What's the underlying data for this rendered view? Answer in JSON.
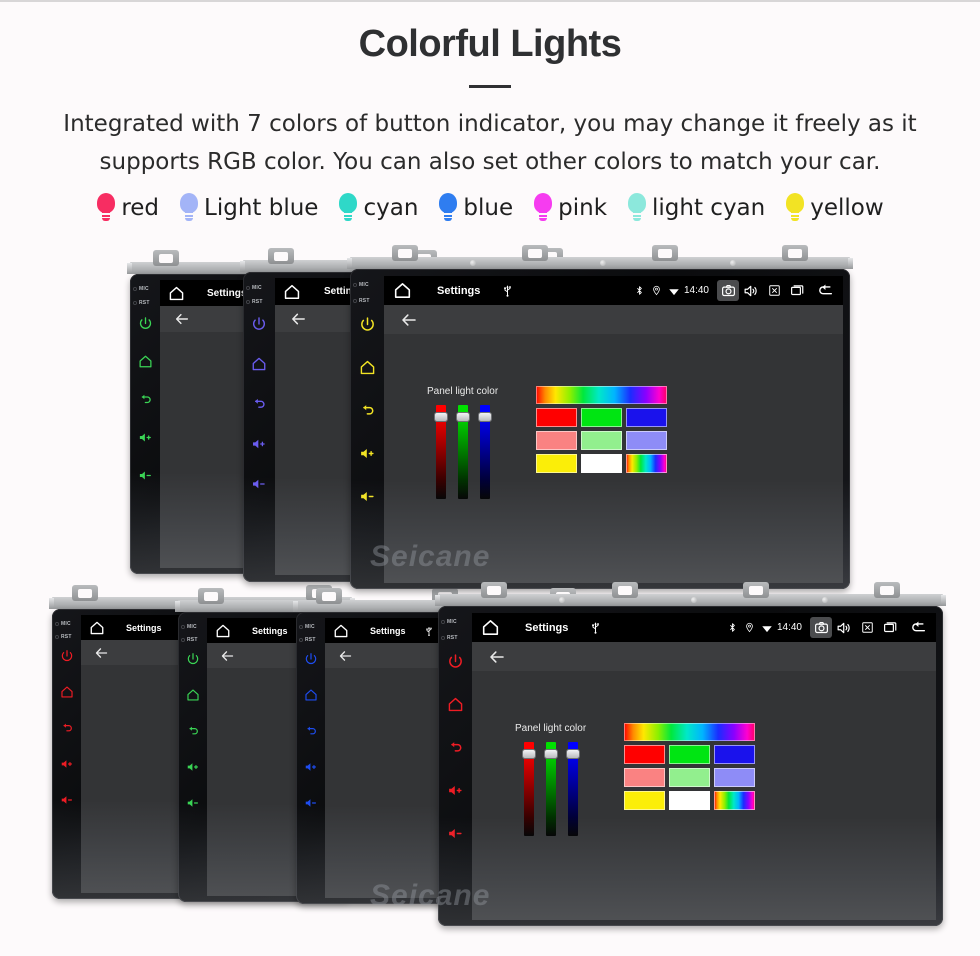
{
  "header": {
    "title": "Colorful Lights",
    "subtitle": "Integrated with 7 colors of button indicator, you may change it freely as it supports RGB color. You can also set other colors to match your car."
  },
  "legend": {
    "items": [
      {
        "label": "red",
        "color": "#f72d62",
        "icon": "bulb-icon"
      },
      {
        "label": "Light blue",
        "color": "#a3b4f7",
        "icon": "bulb-icon"
      },
      {
        "label": "cyan",
        "color": "#2fd8c8",
        "icon": "bulb-icon"
      },
      {
        "label": "blue",
        "color": "#2f7df0",
        "icon": "bulb-icon"
      },
      {
        "label": "pink",
        "color": "#f63cf0",
        "icon": "bulb-icon"
      },
      {
        "label": "light cyan",
        "color": "#8ce8dc",
        "icon": "bulb-icon"
      },
      {
        "label": "yellow",
        "color": "#f2e324",
        "icon": "bulb-icon"
      }
    ]
  },
  "device": {
    "bezel_labels": {
      "mic": "MIC",
      "rst": "RST"
    },
    "hardware_buttons": [
      {
        "name": "power-button",
        "icon": "power-icon"
      },
      {
        "name": "home-button",
        "icon": "home-icon"
      },
      {
        "name": "back-button",
        "icon": "return-arrow-icon"
      },
      {
        "name": "volume-up-button",
        "icon": "volume-up-icon"
      },
      {
        "name": "volume-down-button",
        "icon": "volume-down-icon"
      }
    ],
    "statusbar": {
      "home_icon": "home-icon",
      "title": "Settings",
      "usb_icon": "usb-icon",
      "bluetooth_icon": "bluetooth-icon",
      "location_icon": "location-pin-icon",
      "wifi_icon": "wifi-icon",
      "time": "14:40",
      "camera_icon": "camera-icon",
      "volume_icon": "speaker-icon",
      "close_icon": "close-box-icon",
      "recents_icon": "recents-icon",
      "back_icon": "back-arrow-icon"
    },
    "actionbar": {
      "back_icon": "back-arrow-icon"
    },
    "settings_panel": {
      "label": "Panel light color",
      "sliders": [
        {
          "name": "red-slider",
          "top_color": "#ff0000",
          "value_pct": 92
        },
        {
          "name": "green-slider",
          "top_color": "#00e000",
          "value_pct": 92
        },
        {
          "name": "blue-slider",
          "top_color": "#0000ff",
          "value_pct": 92
        }
      ],
      "hue_bar": "rainbow-gradient",
      "swatch_rows": [
        [
          {
            "name": "swatch-red",
            "color": "#ff0000"
          },
          {
            "name": "swatch-green",
            "color": "#00e512"
          },
          {
            "name": "swatch-blue",
            "color": "#1a12ec"
          }
        ],
        [
          {
            "name": "swatch-salmon",
            "color": "#fa8282"
          },
          {
            "name": "swatch-lightgreen",
            "color": "#92ef8e"
          },
          {
            "name": "swatch-periwinkle",
            "color": "#8e8cf7"
          }
        ],
        [
          {
            "name": "swatch-yellow",
            "color": "#fbee08"
          },
          {
            "name": "swatch-white",
            "color": "#ffffff"
          },
          {
            "name": "swatch-rainbow",
            "color": "rainbow"
          }
        ]
      ]
    }
  },
  "units": {
    "top_row": [
      {
        "id": "unit-top-1",
        "button_color": "#3ad455",
        "label": "green"
      },
      {
        "id": "unit-top-2",
        "button_color": "#6a5cf0",
        "label": "blue"
      },
      {
        "id": "unit-top-3",
        "button_color": "#f2e324",
        "label": "yellow"
      }
    ],
    "bottom_row": [
      {
        "id": "unit-bottom-1",
        "button_color": "#ee1c24",
        "label": "red"
      },
      {
        "id": "unit-bottom-2",
        "button_color": "#3ad455",
        "label": "green"
      },
      {
        "id": "unit-bottom-3",
        "button_color": "#1e4df0",
        "label": "blue"
      },
      {
        "id": "unit-bottom-4",
        "button_color": "#ee1c24",
        "label": "red"
      }
    ]
  },
  "watermark": {
    "text": "Seicane"
  }
}
